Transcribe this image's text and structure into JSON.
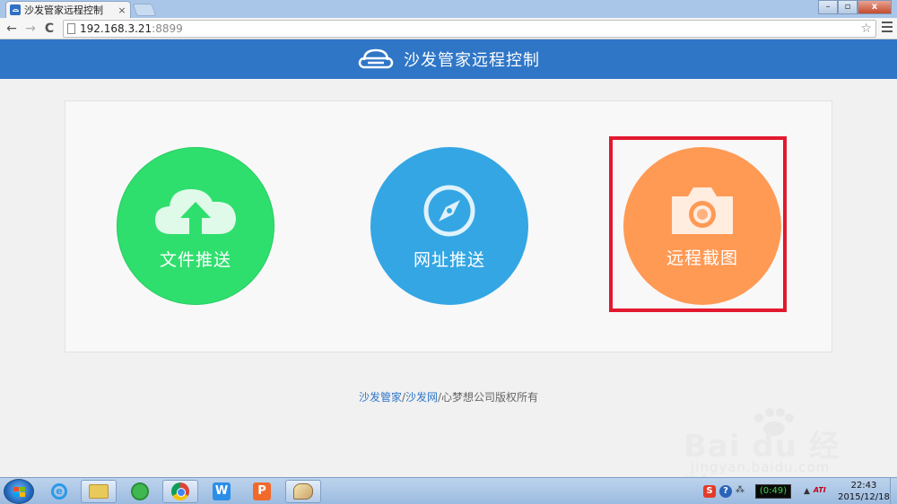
{
  "browser": {
    "tab_title": "沙发管家远程控制",
    "tab_close": "×",
    "url_host": "192.168.3.21",
    "url_port": ":8899",
    "back": "←",
    "forward": "→",
    "reload": "C",
    "star": "☆",
    "win_min": "–",
    "win_max": "▫",
    "win_close": "x"
  },
  "header": {
    "title": "沙发管家远程控制"
  },
  "actions": [
    {
      "label": "文件推送",
      "icon": "cloud-upload-icon",
      "color": "#2fdf6e"
    },
    {
      "label": "网址推送",
      "icon": "compass-icon",
      "color": "#34a6e4"
    },
    {
      "label": "远程截图",
      "icon": "camera-icon",
      "color": "#ff9a55"
    }
  ],
  "footer": {
    "link1": "沙发管家",
    "sep": "/",
    "link2": "沙发网",
    "rest": "/心梦想公司版权所有"
  },
  "watermark": {
    "brand": "Bai du 经验",
    "site": "jingyan.baidu.com"
  },
  "taskbar": {
    "w_label": "W",
    "p_label": "P",
    "ie_label": "e",
    "tray_s": "S",
    "tray_help": "?",
    "battery": "(0:49)",
    "ati": "ATI",
    "arrow": "▲",
    "time": "22:43",
    "date": "2015/12/18"
  },
  "colors": {
    "header_blue": "#2f76c7",
    "highlight_red": "#e2192f"
  }
}
